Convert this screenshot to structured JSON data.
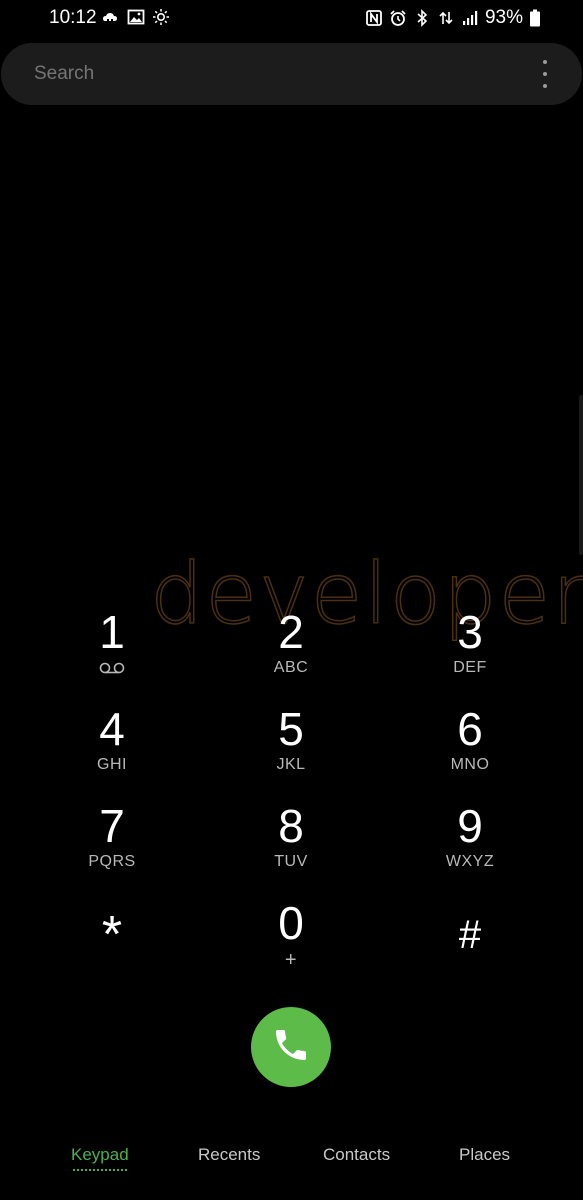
{
  "status_bar": {
    "time": "10:12",
    "battery": "93%",
    "left_icons": [
      "weather-icon",
      "gallery-icon",
      "sun-icon"
    ],
    "right_icons": [
      "nfc-icon",
      "alarm-icon",
      "bluetooth-icon",
      "data-icon",
      "signal-icon",
      "battery-icon"
    ]
  },
  "search": {
    "placeholder": "Search"
  },
  "watermark": "developers",
  "keypad": {
    "keys": [
      {
        "digit": "1",
        "letters": ""
      },
      {
        "digit": "2",
        "letters": "ABC"
      },
      {
        "digit": "3",
        "letters": "DEF"
      },
      {
        "digit": "4",
        "letters": "GHI"
      },
      {
        "digit": "5",
        "letters": "JKL"
      },
      {
        "digit": "6",
        "letters": "MNO"
      },
      {
        "digit": "7",
        "letters": "PQRS"
      },
      {
        "digit": "8",
        "letters": "TUV"
      },
      {
        "digit": "9",
        "letters": "WXYZ"
      },
      {
        "digit": "*",
        "letters": ""
      },
      {
        "digit": "0",
        "letters": "+"
      },
      {
        "digit": "#",
        "letters": ""
      }
    ]
  },
  "call_button": {
    "icon": "phone-icon",
    "color": "#5dbb4a"
  },
  "bottom_nav": {
    "tabs": [
      {
        "label": "Keypad",
        "active": true
      },
      {
        "label": "Recents",
        "active": false
      },
      {
        "label": "Contacts",
        "active": false
      },
      {
        "label": "Places",
        "active": false
      }
    ],
    "active_color": "#4caf50"
  }
}
